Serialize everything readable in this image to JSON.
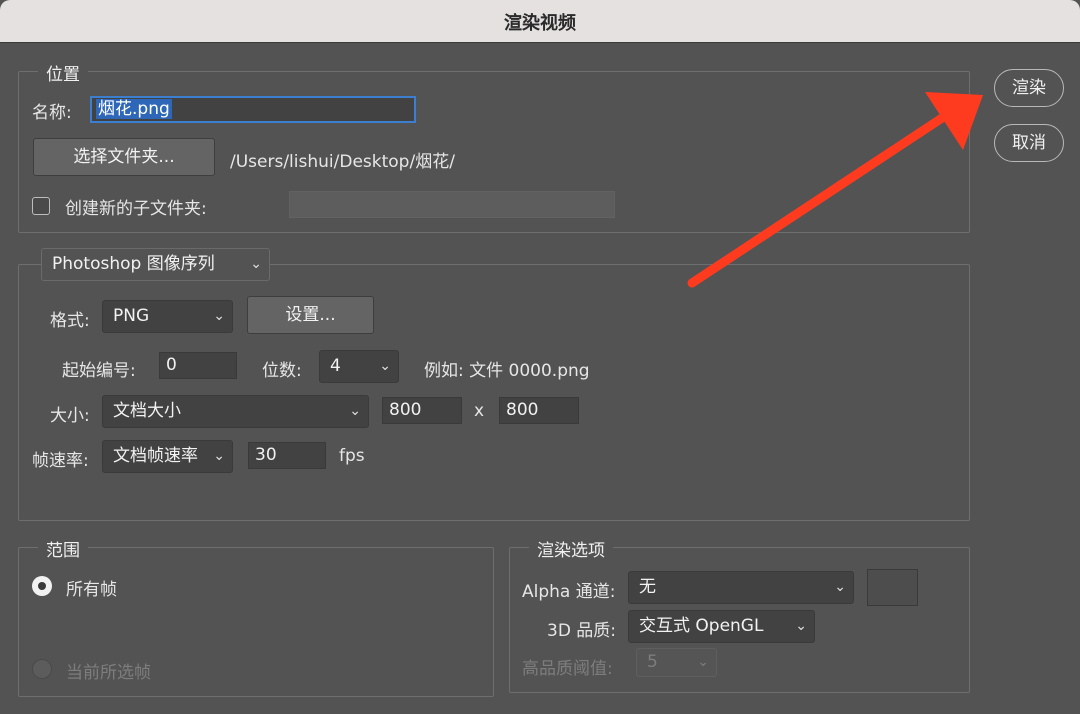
{
  "window": {
    "title": "渲染视频"
  },
  "actions": {
    "render": "渲染",
    "cancel": "取消"
  },
  "location": {
    "legend": "位置",
    "name_label": "名称:",
    "name_value": "烟花.png",
    "choose_folder": "选择文件夹...",
    "path": "/Users/lishui/Desktop/烟花/",
    "subfolder_label": "创建新的子文件夹:",
    "subfolder_checked": false,
    "subfolder_value": ""
  },
  "sequence": {
    "type": "Photoshop 图像序列",
    "format_label": "格式:",
    "format_value": "PNG",
    "settings_button": "设置...",
    "start_label": "起始编号:",
    "start_value": "0",
    "digits_label": "位数:",
    "digits_value": "4",
    "example": "例如: 文件 0000.png",
    "size_label": "大小:",
    "size_value": "文档大小",
    "width": "800",
    "x": "x",
    "height": "800",
    "fps_label": "帧速率:",
    "fps_select": "文档帧速率",
    "fps_value": "30",
    "fps_unit": "fps"
  },
  "range": {
    "legend": "范围",
    "all_frames": "所有帧",
    "current_frames": "当前所选帧",
    "selected": "all_frames"
  },
  "render_options": {
    "legend": "渲染选项",
    "alpha_label": "Alpha 通道:",
    "alpha_value": "无",
    "quality_label": "3D 品质:",
    "quality_value": "交互式 OpenGL",
    "threshold_label": "高品质阈值:",
    "threshold_value": "5"
  },
  "colors": {
    "arrow": "#ff3b1f",
    "accent": "#2f7fd8"
  }
}
